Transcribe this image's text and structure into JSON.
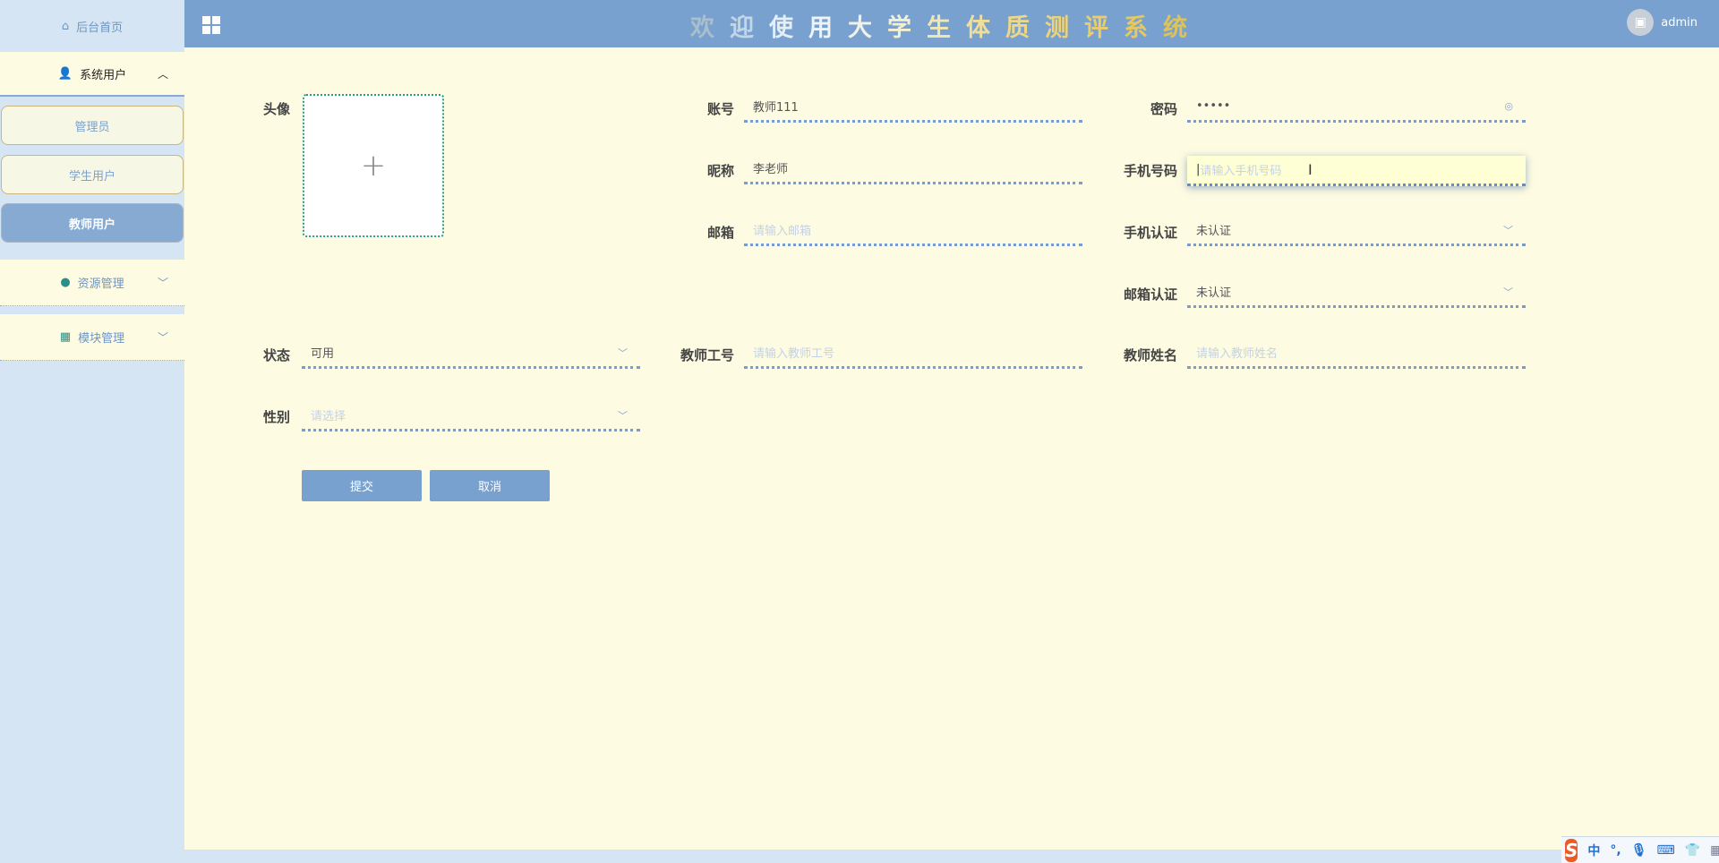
{
  "sidebar": {
    "home": "后台首页",
    "groups": [
      {
        "label": "系统用户",
        "expanded": true
      },
      {
        "label": "资源管理"
      },
      {
        "label": "模块管理"
      }
    ],
    "sub_items": [
      {
        "label": "管理员"
      },
      {
        "label": "学生用户"
      },
      {
        "label": "教师用户",
        "active": true
      }
    ]
  },
  "header": {
    "title_chars": [
      "欢",
      "迎",
      "使",
      "用",
      "大",
      "学",
      "生",
      "体",
      "质",
      "测",
      "评",
      "系",
      "统"
    ],
    "user": "admin"
  },
  "form": {
    "avatar_label": "头像",
    "account": {
      "label": "账号",
      "value": "教师111"
    },
    "password": {
      "label": "密码",
      "value": "•••••"
    },
    "nickname": {
      "label": "昵称",
      "value": "李老师"
    },
    "phone": {
      "label": "手机号码",
      "placeholder": "请输入手机号码"
    },
    "email": {
      "label": "邮箱",
      "placeholder": "请输入邮箱"
    },
    "phone_verify": {
      "label": "手机认证",
      "value": "未认证"
    },
    "email_verify": {
      "label": "邮箱认证",
      "value": "未认证"
    },
    "status": {
      "label": "状态",
      "value": "可用"
    },
    "teacher_no": {
      "label": "教师工号",
      "placeholder": "请输入教师工号"
    },
    "teacher_name": {
      "label": "教师姓名",
      "placeholder": "请输入教师姓名"
    },
    "gender": {
      "label": "性别",
      "placeholder": "请选择"
    },
    "submit": "提交",
    "cancel": "取消"
  },
  "ime": {
    "mode": "中",
    "punct": "°,"
  }
}
